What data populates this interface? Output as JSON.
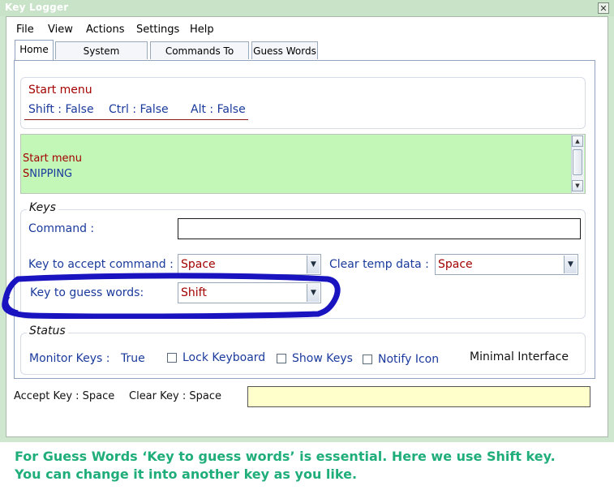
{
  "window": {
    "title": "Key Logger",
    "close_glyph": "✕"
  },
  "menu": [
    "File",
    "View",
    "Actions",
    "Settings",
    "Help"
  ],
  "tabs": [
    "Home",
    "System Commands",
    "Commands To Open",
    "Guess Words"
  ],
  "header": {
    "current": "Start menu",
    "shift": "Shift : False",
    "ctrl": "Ctrl : False",
    "alt": "Alt : False"
  },
  "log": {
    "line1": "Start menu",
    "line2_first": "S",
    "line2_rest": "NIPPING"
  },
  "keys": {
    "title": "Keys",
    "command_label": "Command :",
    "command_value": "",
    "accept_label": "Key to accept command :",
    "accept_value": "Space",
    "clear_label": "Clear temp data :",
    "clear_value": "Space",
    "guess_label": "Key to guess words:",
    "guess_value": "Shift"
  },
  "status": {
    "title": "Status",
    "monitor_label": "Monitor Keys :",
    "monitor_value": "True",
    "lock_label": "Lock Keyboard",
    "show_label": "Show Keys",
    "notify_label": "Notify Icon",
    "minimal_label": "Minimal Interface"
  },
  "footer": {
    "accept": "Accept Key : Space",
    "clear": "Clear Key : Space",
    "field_value": ""
  },
  "caption": {
    "line1": "For Guess Words ‘Key to guess words’ is essential. Here we use Shift key.",
    "line2": "You can change it into another key as you like."
  },
  "colors": {
    "log_bg": "#c2f7b8",
    "footer_field_bg": "#ffffcc",
    "highlight": "#1a14c0",
    "caption": "#1fae7a"
  }
}
